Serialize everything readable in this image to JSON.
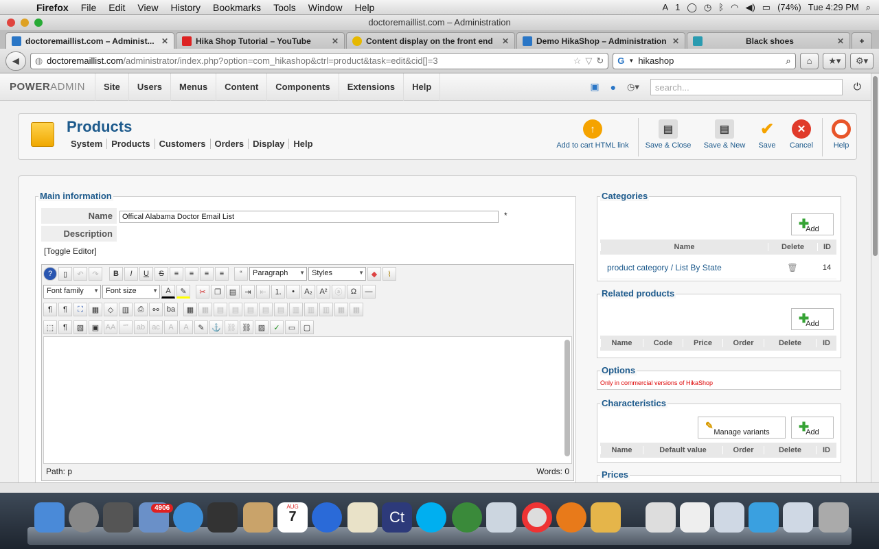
{
  "os_menu": {
    "app": "Firefox",
    "items": [
      "File",
      "Edit",
      "View",
      "History",
      "Bookmarks",
      "Tools",
      "Window",
      "Help"
    ],
    "battery": "(74%)",
    "clock": "Tue 4:29 PM",
    "notif": "1"
  },
  "window": {
    "title": "doctoremaillist.com – Administration"
  },
  "tabs": [
    {
      "label": "doctoremaillist.com – Administ...",
      "fav": "#2a76c6"
    },
    {
      "label": "Hika Shop Tutorial – YouTube",
      "fav": "#d22"
    },
    {
      "label": "Content display on the front end",
      "fav": "#e6b800"
    },
    {
      "label": "Demo HikaShop – Administration",
      "fav": "#2a76c6"
    },
    {
      "label": "Black shoes",
      "fav": "#2a9bb0"
    }
  ],
  "nav": {
    "url_host": "doctoremaillist.com",
    "url_path": "/administrator/index.php?option=com_hikashop&ctrl=product&task=edit&cid[]=3",
    "search_value": "hikashop"
  },
  "admin": {
    "logo_bold": "POWER",
    "logo_light": "ADMIN",
    "menus": [
      "Site",
      "Users",
      "Menus",
      "Content",
      "Components",
      "Extensions",
      "Help"
    ],
    "search_placeholder": "search..."
  },
  "header": {
    "title": "Products",
    "submenu": [
      "System",
      "Products",
      "Customers",
      "Orders",
      "Display",
      "Help"
    ],
    "toolbar": {
      "add_cart": "Add to cart HTML link",
      "save_close": "Save & Close",
      "save_new": "Save & New",
      "save": "Save",
      "cancel": "Cancel",
      "help": "Help"
    }
  },
  "main": {
    "legend": "Main information",
    "name_label": "Name",
    "name_value": "Offical Alabama Doctor Email List",
    "required": "*",
    "desc_label": "Description",
    "toggle_editor": "[Toggle Editor]",
    "editor": {
      "format": "Paragraph",
      "styles": "Styles",
      "font_family": "Font family",
      "font_size": "Font size",
      "path": "Path:  p",
      "words": "Words: 0"
    }
  },
  "categories": {
    "legend": "Categories",
    "add": "Add",
    "cols": [
      "Name",
      "Delete",
      "ID"
    ],
    "row": {
      "name": "product category / List By State",
      "id": "14"
    }
  },
  "related": {
    "legend": "Related products",
    "add": "Add",
    "cols": [
      "Name",
      "Code",
      "Price",
      "Order",
      "Delete",
      "ID"
    ]
  },
  "options": {
    "legend": "Options",
    "note": "Only in commercial versions of HikaShop"
  },
  "characteristics": {
    "legend": "Characteristics",
    "manage": "Manage variants",
    "add": "Add",
    "cols": [
      "Name",
      "Default value",
      "Order",
      "Delete",
      "ID"
    ]
  },
  "prices": {
    "legend": "Prices"
  },
  "dock": {
    "mail_badge": "4906",
    "calendar_day": "7",
    "calendar_month": "AUG"
  }
}
